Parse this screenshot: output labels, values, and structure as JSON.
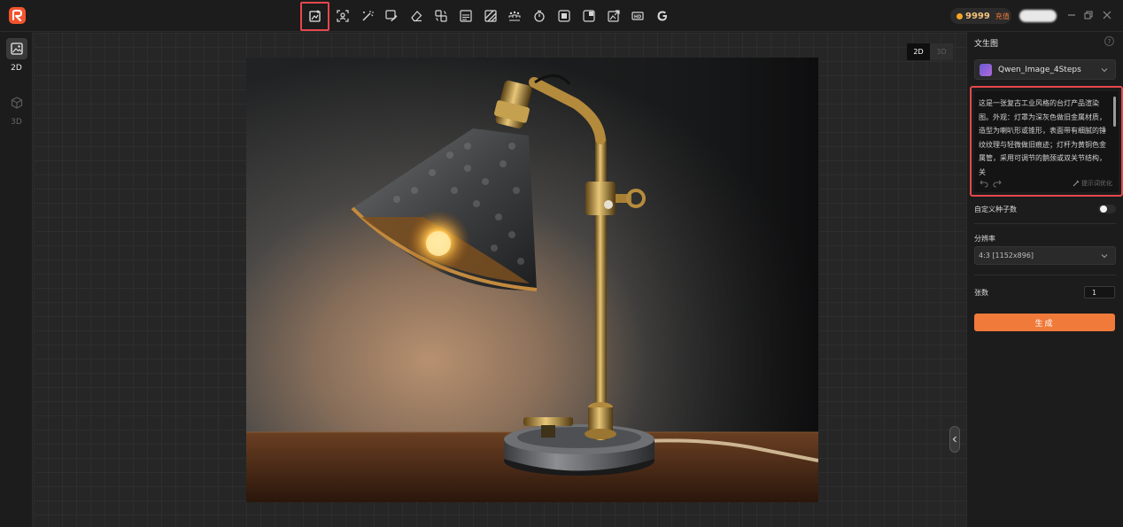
{
  "app": {
    "logo": "app-logo-icon"
  },
  "toolbar": {
    "tools": [
      "image-edit-icon",
      "face-scan-icon",
      "magic-wand-icon",
      "brush-icon",
      "eraser-icon",
      "swap-icon",
      "texture-icon",
      "hatch-icon",
      "crowd-icon",
      "timer-icon",
      "layer-icon",
      "contrast-icon",
      "image-export-icon",
      "hd-icon",
      "google-icon"
    ],
    "active_tool": "image-edit-icon"
  },
  "account": {
    "coins": "9999",
    "recharge_label": "充值",
    "coin_color": "#f5a623",
    "accent_color": "#f07a3a"
  },
  "left_rail": {
    "modes": [
      {
        "label": "2D",
        "icon": "image-icon"
      },
      {
        "label": "3D",
        "icon": "cube-icon"
      }
    ]
  },
  "canvas": {
    "dimension_toggle": [
      "2D",
      "3D"
    ],
    "active_dimension": "2D"
  },
  "panel": {
    "title": "文生图",
    "help": "?",
    "model": "Qwen_Image_4Steps",
    "prompt": "这是一张复古工业风格的台灯产品渲染图。外观：灯罩为深灰色做旧金属材质，造型为喇叭形或锥形，表面带有细腻的锤纹纹理与轻微做旧痕迹；灯杆为黄铜色金属管，采用可调节的鹅颈或双关节结构，关",
    "prompt_optimize_label": "提示词优化",
    "seed_label": "自定义种子数",
    "seed_enabled": false,
    "resolution_label": "分辨率",
    "resolution_value": "4:3 [1152x896]",
    "count_label": "张数",
    "count_value": "1",
    "generate_label": "生成",
    "highlight_color": "#e5484d"
  }
}
